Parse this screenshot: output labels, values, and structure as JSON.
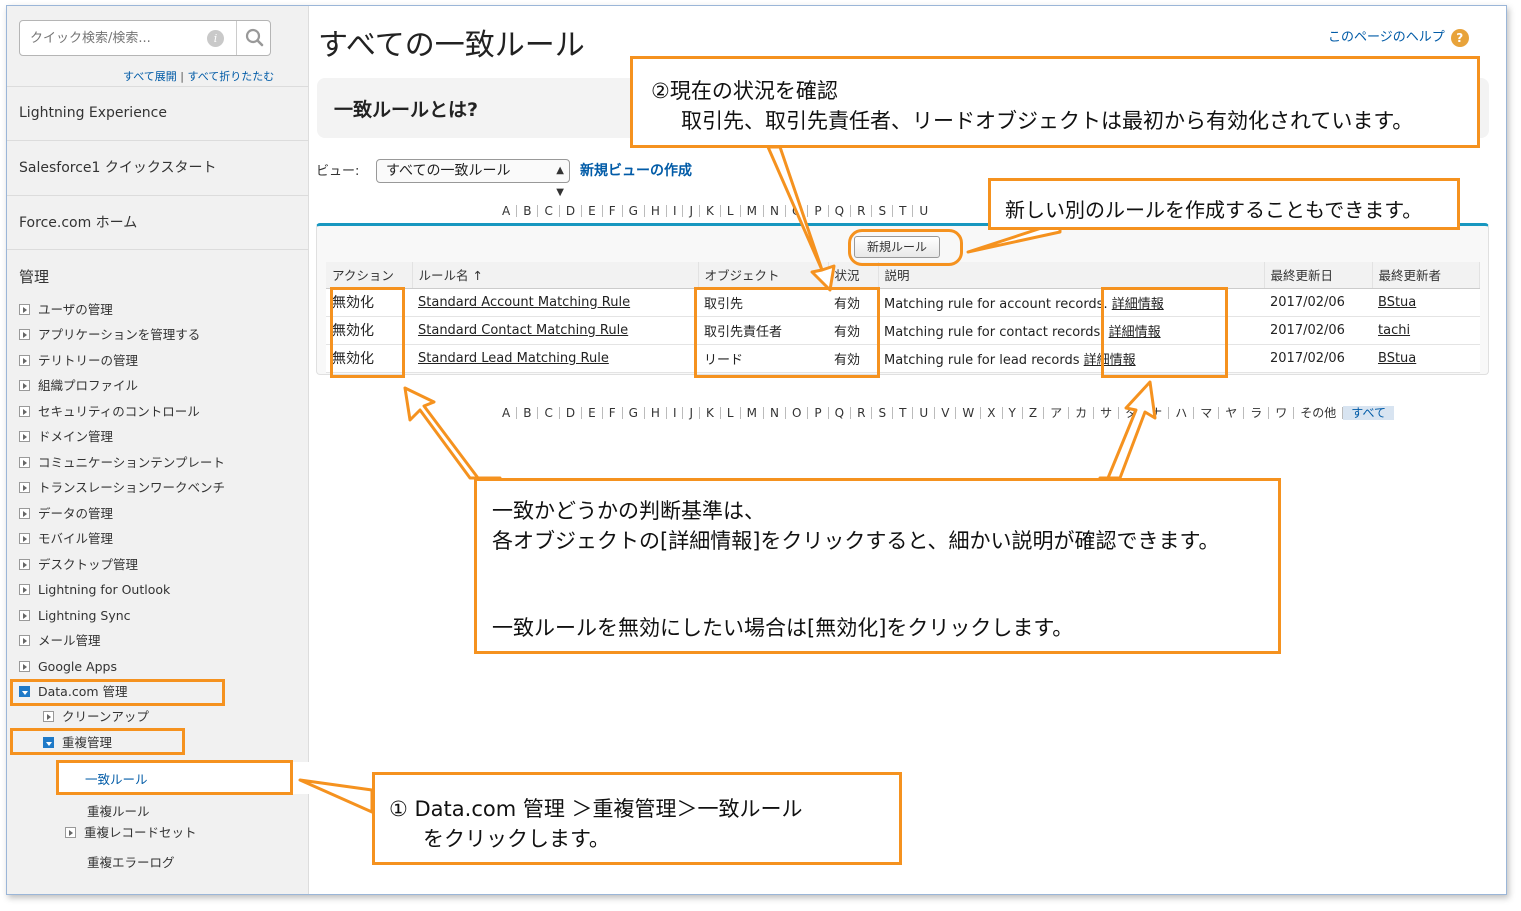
{
  "sidebar": {
    "search_placeholder": "クイック検索/検索...",
    "expand_all": "すべて展開",
    "collapse_all": "すべて折りたたむ",
    "sep": "|",
    "top_items": [
      "Lightning Experience",
      "Salesforce1 クイックスタート",
      "Force.com ホーム"
    ],
    "admin_heading": "管理",
    "tree": [
      "ユーザの管理",
      "アプリケーションを管理する",
      "テリトリーの管理",
      "組織プロファイル",
      "セキュリティのコントロール",
      "ドメイン管理",
      "コミュニケーションテンプレート",
      "トランスレーションワークベンチ",
      "データの管理",
      "モバイル管理",
      "デスクトップ管理",
      "Lightning for Outlook",
      "Lightning Sync",
      "メール管理",
      "Google Apps"
    ],
    "datacom": "Data.com 管理",
    "cleanup": "クリーンアップ",
    "duplicate": "重複管理",
    "matching_rules": "一致ルール",
    "duplicate_rules": "重複ルール",
    "duplicate_record_sets": "重複レコードセット",
    "duplicate_error_log": "重複エラーログ"
  },
  "main": {
    "title": "すべての一致ルール",
    "help": "このページのヘルプ",
    "help_icon": "?",
    "intro": "一致ルールとは?",
    "view_label": "ビュー:",
    "view_value": "すべての一致ルール",
    "new_view": "新規ビューの作成",
    "alpha": [
      "A",
      "B",
      "C",
      "D",
      "E",
      "F",
      "G",
      "H",
      "I",
      "J",
      "K",
      "L",
      "M",
      "N",
      "O",
      "P",
      "Q",
      "R",
      "S",
      "T",
      "U",
      "V",
      "W",
      "X",
      "Y",
      "Z",
      "ア",
      "カ",
      "サ",
      "タ",
      "ナ",
      "ハ",
      "マ",
      "ヤ",
      "ラ",
      "ワ",
      "その他"
    ],
    "alpha_all": "すべて",
    "new_rule": "新規ルール",
    "columns": [
      "アクション",
      "ルール名 ↑",
      "オブジェクト",
      "状況",
      "説明",
      "最終更新日",
      "最終更新者"
    ],
    "rows": [
      {
        "action": "無効化",
        "name": "Standard Account Matching Rule",
        "object": "取引先",
        "status": "有効",
        "desc": "Matching rule for account records.",
        "detail": "詳細情報",
        "date": "2017/02/06",
        "by": "BStua"
      },
      {
        "action": "無効化",
        "name": "Standard Contact Matching Rule",
        "object": "取引先責任者",
        "status": "有効",
        "desc": "Matching rule for contact records.",
        "detail": "詳細情報",
        "date": "2017/02/06",
        "by": "tachi"
      },
      {
        "action": "無効化",
        "name": "Standard Lead Matching Rule",
        "object": "リード",
        "status": "有効",
        "desc": "Matching rule for lead records",
        "detail": "詳細情報",
        "date": "2017/02/06",
        "by": "BStua"
      }
    ]
  },
  "callouts": {
    "c2_line1": "②現在の状況を確認",
    "c2_line2": "取引先、取引先責任者、リードオブジェクトは最初から有効化されています。",
    "new_rule_note": "新しい別のルールを作成することもできます。",
    "big_line1": "一致かどうかの判断基準は、",
    "big_line2": "各オブジェクトの[詳細情報]をクリックすると、細かい説明が確認できます。",
    "big_line3": "一致ルールを無効にしたい場合は[無効化]をクリックします。",
    "c1_line1": "① Data.com 管理 ＞重複管理＞一致ルール",
    "c1_line2": "をクリックします。"
  },
  "colors": {
    "accent": "#f5921f",
    "link": "#015ba7"
  }
}
